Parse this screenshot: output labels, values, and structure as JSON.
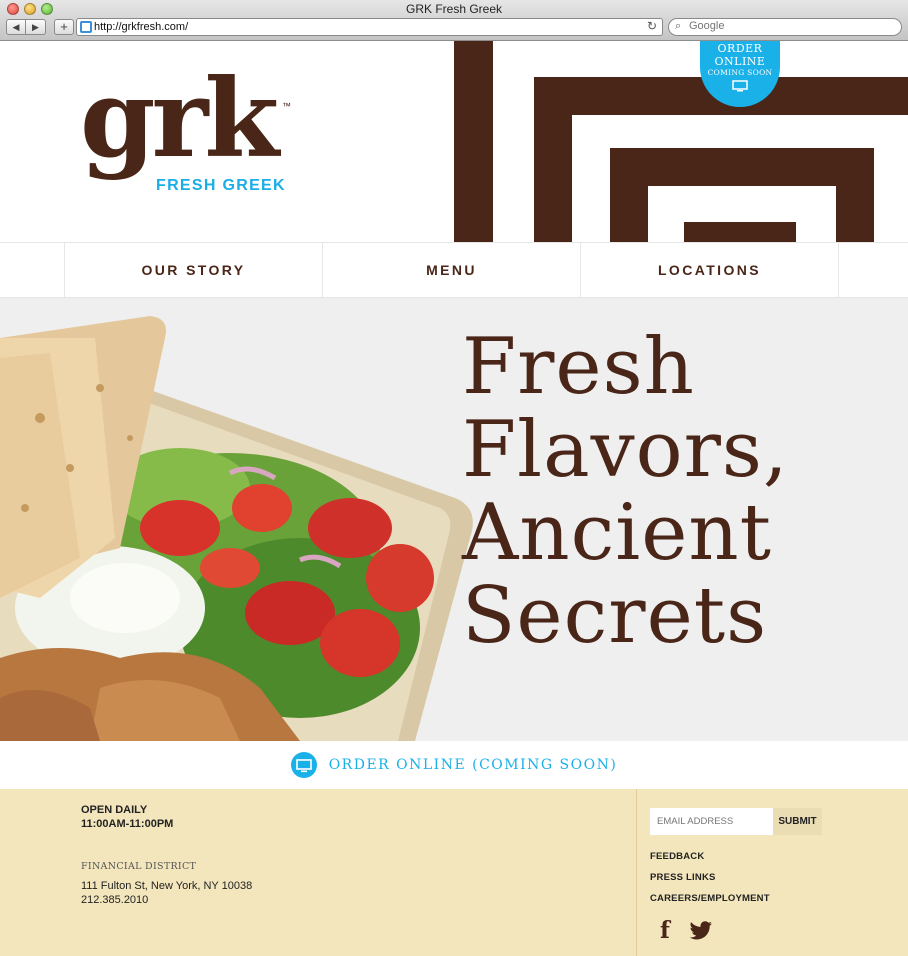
{
  "browser": {
    "window_title": "GRK Fresh Greek",
    "back_label": "◀",
    "forward_label": "▶",
    "add_label": "+",
    "url": "http://grkfresh.com/",
    "reload_label": "↻",
    "search_placeholder": "Google"
  },
  "header": {
    "logo_word": "grk",
    "logo_tm": "™",
    "logo_tagline": "FRESH GREEK",
    "order_badge": {
      "line1": "ORDER",
      "line2": "ONLINE",
      "line3": "COMING SOON"
    }
  },
  "nav": {
    "items": [
      {
        "label": "OUR STORY"
      },
      {
        "label": "MENU"
      },
      {
        "label": "LOCATIONS"
      }
    ]
  },
  "hero": {
    "headline": [
      "Fresh",
      "Flavors,",
      "Ancient",
      "Secrets"
    ]
  },
  "order_bar": {
    "label": "ORDER ONLINE (COMING SOON)"
  },
  "footer": {
    "hours_title": "OPEN DAILY",
    "hours_time": "11:00AM-11:00PM",
    "location_name": "FINANCIAL DISTRICT",
    "address": "111 Fulton St, New York, NY 10038",
    "phone": "212.385.2010",
    "email_placeholder": "EMAIL ADDRESS",
    "submit_label": "SUBMIT",
    "links": [
      {
        "label": "FEEDBACK"
      },
      {
        "label": "PRESS LINKS"
      },
      {
        "label": "CAREERS/EMPLOYMENT"
      }
    ],
    "facebook_glyph": "f"
  },
  "colors": {
    "brand_brown": "#4a2618",
    "accent_blue": "#1ab0e8",
    "footer_cream": "#f3e6bd",
    "hero_bg": "#efefef"
  },
  "icons": [
    "search-icon",
    "reload-icon",
    "monitor-icon",
    "facebook-icon",
    "twitter-icon"
  ]
}
